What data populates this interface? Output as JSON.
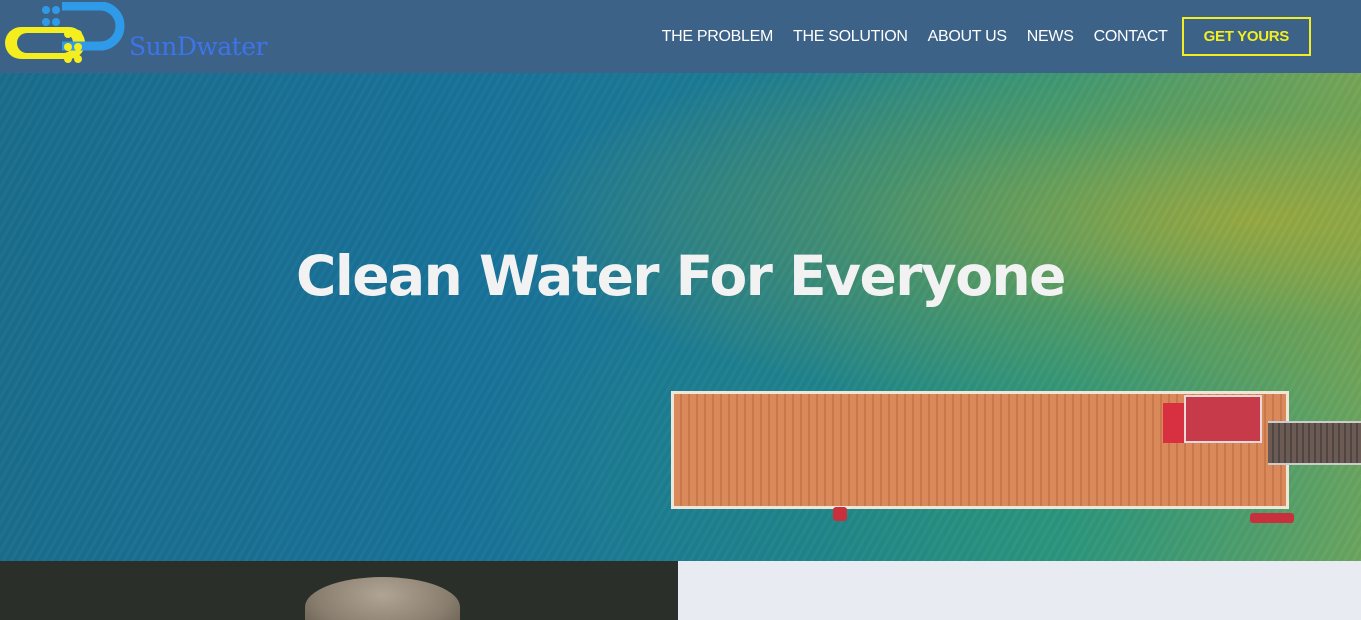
{
  "header": {
    "brand": "SunDwater",
    "nav": [
      "THE PROBLEM",
      "THE SOLUTION",
      "ABOUT US",
      "NEWS",
      "CONTACT"
    ],
    "cta": "GET YOURS"
  },
  "hero": {
    "title": "Clean Water For Everyone"
  },
  "colors": {
    "header_bg": "#3d6287",
    "accent_yellow": "#f2ee23",
    "logo_blue": "#3d74ea"
  }
}
